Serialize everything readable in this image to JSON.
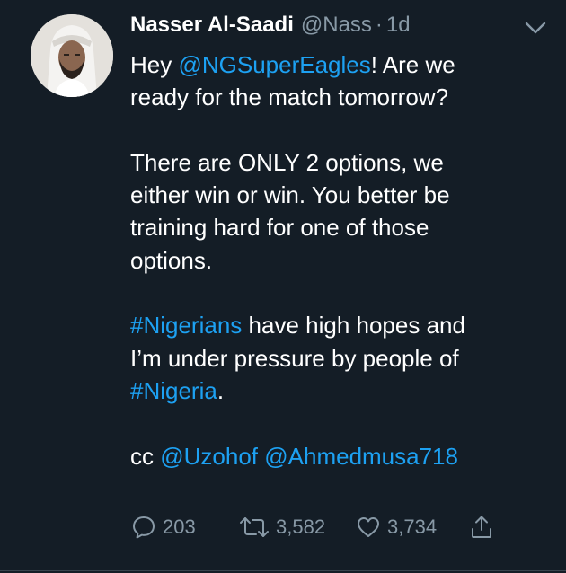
{
  "tweet": {
    "author_name": "Nasser Al-Saadi",
    "author_handle": "@Nass",
    "separator": "·",
    "timestamp": "1d",
    "text": {
      "l1_mention": "@NGSuperEagles",
      "l1_prefix": "Hey ",
      "l1_suffix": "! Are we",
      "l2": "ready for the match tomorrow?",
      "l3": "There are ONLY 2 options, we",
      "l4": "either win or win. You better be",
      "l5": "training hard for one of those",
      "l6": "options.",
      "l7_hashtag": "#Nigerians",
      "l7_suffix": " have high hopes and",
      "l8": "I’m under pressure by people of",
      "l9_hashtag": "#Nigeria",
      "l9_suffix": ".",
      "l10_prefix": "cc ",
      "l10_mention1": "@Uzohof",
      "l10_space": " ",
      "l10_mention2": "@Ahmedmusa718"
    },
    "actions": {
      "reply_count": "203",
      "retweet_count": "3,582",
      "like_count": "3,734"
    }
  },
  "colors": {
    "background": "#141d26",
    "text": "#ffffff",
    "secondary": "#8899a6",
    "link": "#1da1f2"
  },
  "icons": [
    "chevron-down-icon",
    "reply-icon",
    "retweet-icon",
    "like-icon",
    "share-icon"
  ]
}
